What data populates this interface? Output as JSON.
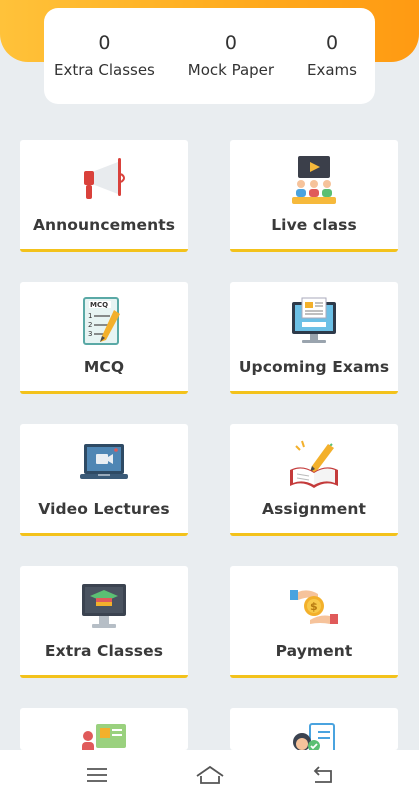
{
  "stats": [
    {
      "value": "0",
      "label": "Extra Classes"
    },
    {
      "value": "0",
      "label": "Mock Paper"
    },
    {
      "value": "0",
      "label": "Exams"
    }
  ],
  "tiles": [
    {
      "label": "Announcements",
      "icon": "megaphone-icon"
    },
    {
      "label": "Live class",
      "icon": "live-class-icon"
    },
    {
      "label": "MCQ",
      "icon": "mcq-icon"
    },
    {
      "label": "Upcoming Exams",
      "icon": "monitor-exam-icon"
    },
    {
      "label": "Video Lectures",
      "icon": "video-laptop-icon"
    },
    {
      "label": "Assignment",
      "icon": "open-book-pencil-icon"
    },
    {
      "label": "Extra Classes",
      "icon": "monitor-graduation-icon"
    },
    {
      "label": "Payment",
      "icon": "payment-hand-coin-icon"
    },
    {
      "label": "",
      "icon": "id-card-icon"
    },
    {
      "label": "",
      "icon": "support-checklist-icon"
    }
  ],
  "nav": {
    "menu_icon": "menu-icon",
    "home_icon": "home-icon",
    "back_icon": "back-icon"
  },
  "colors": {
    "banner_start": "#ffc23a",
    "banner_end": "#ff9a12",
    "tile_accent": "#f3c21b",
    "background": "#e9edf0"
  }
}
